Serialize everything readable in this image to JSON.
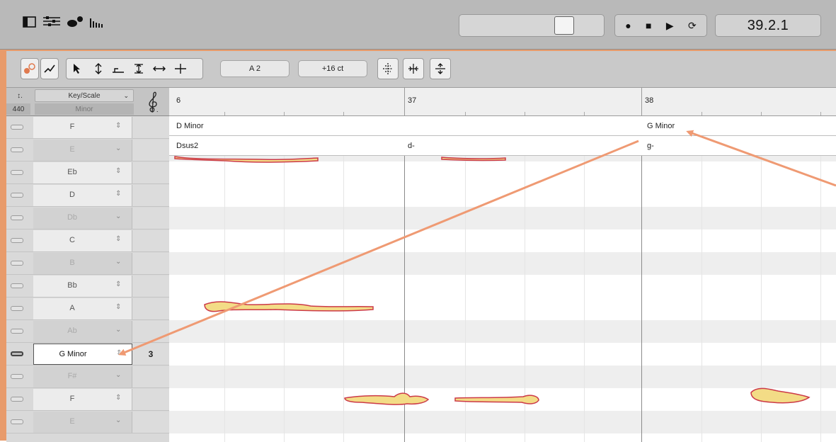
{
  "topbar": {
    "icons": [
      "sidebar-icon",
      "mixer-icon",
      "blob-icon",
      "spectrum-icon"
    ],
    "transport": {
      "record": "●",
      "stop": "■",
      "play": "▶",
      "loop": "⟳"
    },
    "time_display": "39.2.1"
  },
  "toolbar": {
    "pitch_field": "A 2",
    "cents_field": "+16 ct"
  },
  "column_headers": {
    "tuning_icon": "↕.",
    "tuning_value": "440",
    "key_scale_label": "Key/Scale",
    "key_scale_value": "Minor",
    "clef_icon": "treble-clef-icon"
  },
  "ruler": {
    "bars": [
      "6",
      "37",
      "38"
    ]
  },
  "key_rows": [
    {
      "name": "F",
      "arrow": "⇕",
      "dim": false,
      "num": ""
    },
    {
      "name": "E",
      "arrow": "⌄",
      "dim": true,
      "num": ""
    },
    {
      "name": "Eb",
      "arrow": "⇕",
      "dim": false,
      "num": ""
    },
    {
      "name": "D",
      "arrow": "⇕",
      "dim": false,
      "num": ""
    },
    {
      "name": "Db",
      "arrow": "⌄",
      "dim": true,
      "num": ""
    },
    {
      "name": "C",
      "arrow": "⇕",
      "dim": false,
      "num": ""
    },
    {
      "name": "B",
      "arrow": "⌄",
      "dim": true,
      "num": ""
    },
    {
      "name": "Bb",
      "arrow": "⇕",
      "dim": false,
      "num": ""
    },
    {
      "name": "A",
      "arrow": "⇕",
      "dim": false,
      "num": ""
    },
    {
      "name": "Ab",
      "arrow": "⌄",
      "dim": true,
      "num": ""
    },
    {
      "name": "G Minor",
      "arrow": "⇕",
      "dim": false,
      "num": "3",
      "selected": true
    },
    {
      "name": "F#",
      "arrow": "⌄",
      "dim": true,
      "num": ""
    },
    {
      "name": "F",
      "arrow": "⇕",
      "dim": false,
      "num": ""
    },
    {
      "name": "E",
      "arrow": "⌄",
      "dim": true,
      "num": ""
    }
  ],
  "key_track": [
    {
      "label": "D Minor"
    },
    {
      "label": "G Minor"
    }
  ],
  "chord_track": [
    {
      "label": "Dsus2"
    },
    {
      "label": "d-"
    },
    {
      "label": "g-"
    }
  ],
  "colors": {
    "accent": "#e89b6b",
    "note_fill": "#f3dc86",
    "note_edge": "#cc3a48",
    "arrow": "#ef9a73"
  }
}
